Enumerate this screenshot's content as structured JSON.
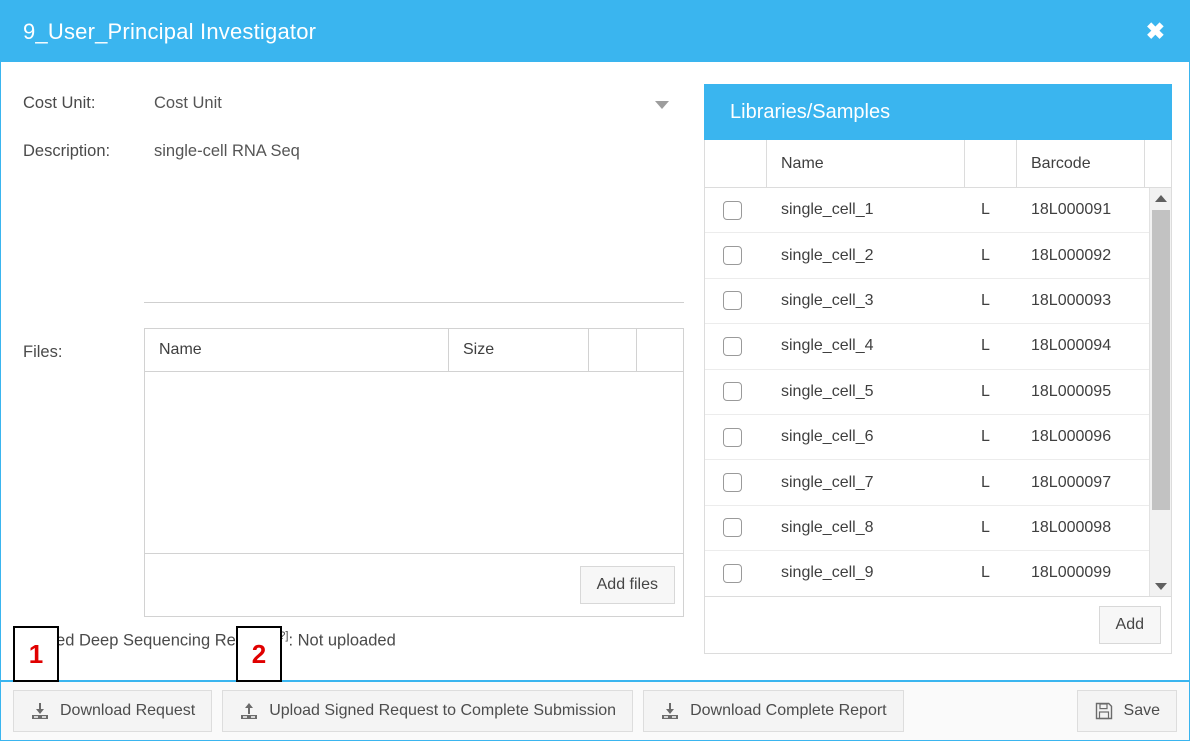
{
  "window": {
    "title": "9_User_Principal Investigator",
    "close_label": "✖",
    "accent_color": "#3ab5ef"
  },
  "form": {
    "cost_unit": {
      "label": "Cost Unit:",
      "value": "Cost Unit",
      "caret": "chevron-down-icon"
    },
    "description": {
      "label": "Description:",
      "value": "single-cell RNA Seq"
    }
  },
  "files": {
    "label": "Files:",
    "columns": [
      "Name",
      "Size",
      "",
      ""
    ],
    "rows": [],
    "add_button": "Add files"
  },
  "signed_request": {
    "text": "Signed Deep Sequencing Request",
    "help": "[?]",
    "suffix": ": Not uploaded"
  },
  "libraries": {
    "title": "Libraries/Samples",
    "columns": [
      "",
      "Name",
      "",
      "Barcode",
      ""
    ],
    "rows": [
      {
        "checked": false,
        "name": "single_cell_1",
        "type": "L",
        "barcode": "18L000091"
      },
      {
        "checked": false,
        "name": "single_cell_2",
        "type": "L",
        "barcode": "18L000092"
      },
      {
        "checked": false,
        "name": "single_cell_3",
        "type": "L",
        "barcode": "18L000093"
      },
      {
        "checked": false,
        "name": "single_cell_4",
        "type": "L",
        "barcode": "18L000094"
      },
      {
        "checked": false,
        "name": "single_cell_5",
        "type": "L",
        "barcode": "18L000095"
      },
      {
        "checked": false,
        "name": "single_cell_6",
        "type": "L",
        "barcode": "18L000096"
      },
      {
        "checked": false,
        "name": "single_cell_7",
        "type": "L",
        "barcode": "18L000097"
      },
      {
        "checked": false,
        "name": "single_cell_8",
        "type": "L",
        "barcode": "18L000098"
      },
      {
        "checked": false,
        "name": "single_cell_9",
        "type": "L",
        "barcode": "18L000099"
      }
    ],
    "add_button": "Add",
    "scroll_up_icon": "triangle-up-icon",
    "scroll_down_icon": "triangle-down-icon"
  },
  "toolbar": {
    "download_request": {
      "label": "Download Request",
      "icon": "download-icon"
    },
    "upload_signed": {
      "label": "Upload Signed Request to Complete Submission",
      "icon": "upload-icon"
    },
    "download_report": {
      "label": "Download Complete Report",
      "icon": "download-icon"
    },
    "save": {
      "label": "Save",
      "icon": "floppy-disk-icon"
    }
  },
  "annotations": [
    {
      "number": "1"
    },
    {
      "number": "2"
    }
  ]
}
